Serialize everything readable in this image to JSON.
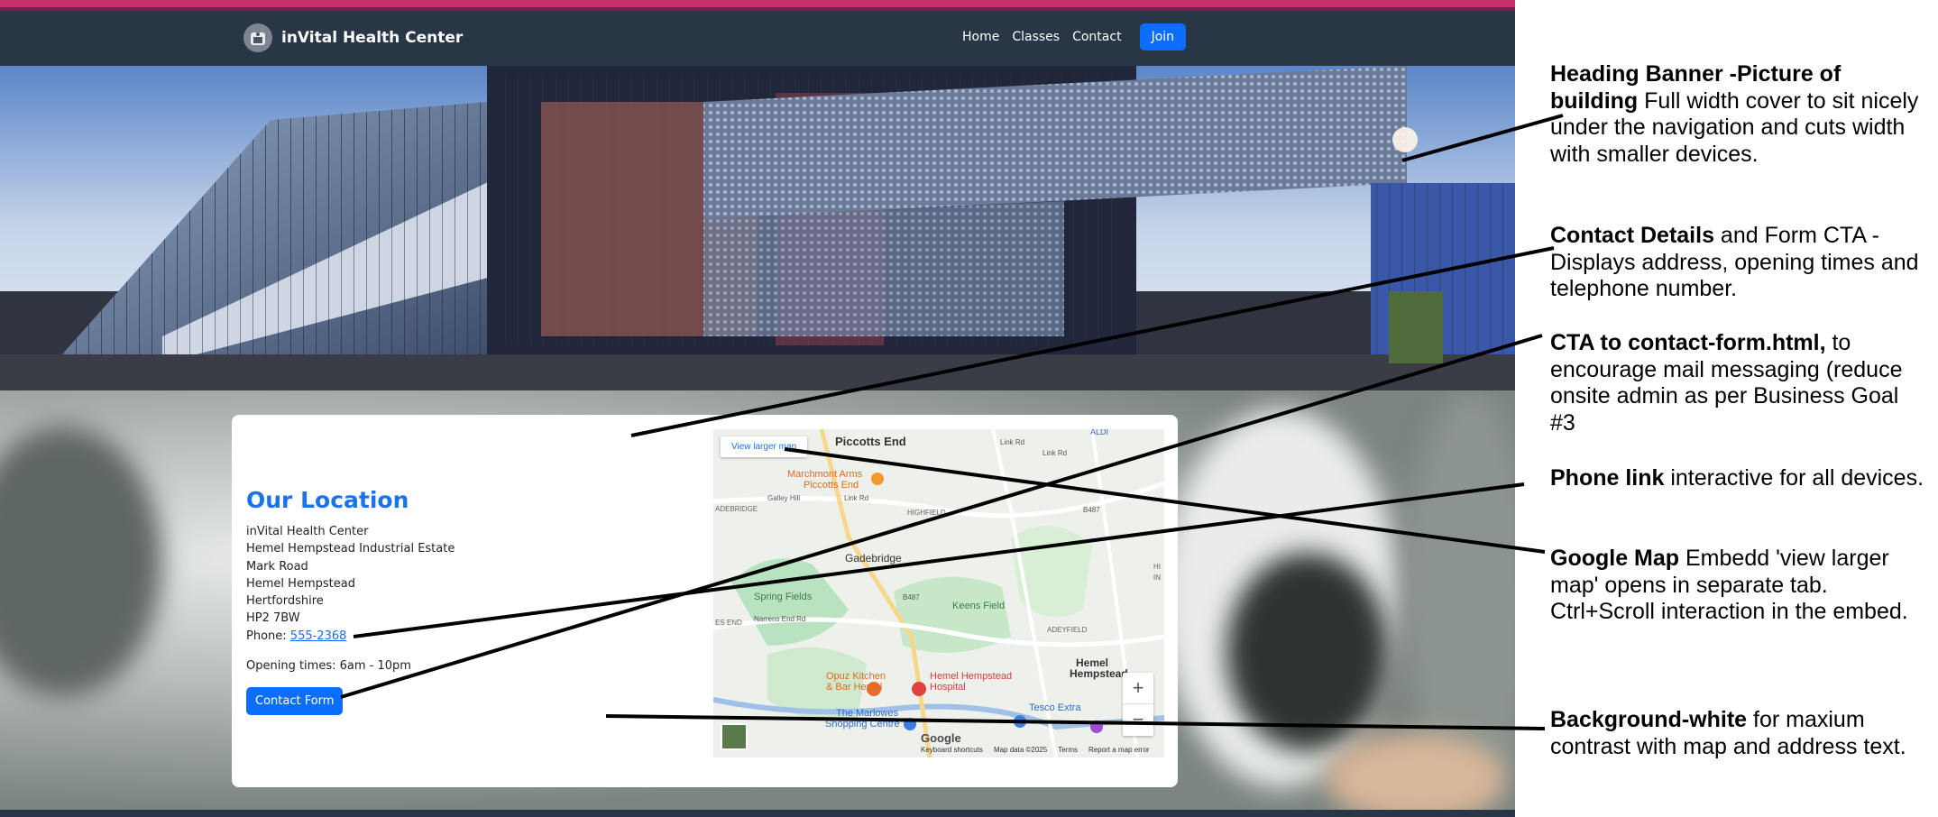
{
  "site": {
    "brand": {
      "name": "inVital Health Center"
    },
    "nav": {
      "items": [
        "Home",
        "Classes",
        "Contact"
      ],
      "join_label": "Join"
    },
    "location": {
      "title": "Our Location",
      "address_lines": [
        "inVital Health Center",
        "Hemel Hempstead Industrial Estate",
        "Mark Road",
        "Hemel Hempstead",
        "Hertfordshire",
        "HP2 7BW"
      ],
      "phone_label": "Phone:",
      "phone_number": "555-2368",
      "opening_times": "Opening times: 6am - 10pm",
      "contact_button": "Contact Form"
    },
    "map": {
      "view_larger": "View larger map",
      "labels": [
        "Piccotts End",
        "Marchmont Arms",
        "Piccotts End",
        "Link Rd",
        "Gadebridge",
        "Spring Fields",
        "Keens Field",
        "Opuz Kitchen",
        "& Bar Hemel",
        "Hemel Hempstead",
        "Hospital",
        "The Marlowes",
        "Shopping Centre",
        "Tesco Extra",
        "Hemel",
        "Hempstead",
        "HIGHFIELD",
        "ADEYFIELD",
        "ADEBRIDGE",
        "B487",
        "B487",
        "Link Rd",
        "Link Rd",
        "Galley Hill",
        "Narrens End Rd",
        "ES END",
        "ALDI",
        "HI",
        "IN"
      ],
      "footer": [
        "Keyboard shortcuts",
        "Map data ©2025",
        "Terms",
        "Report a map error"
      ],
      "google": "Google",
      "zoom_in": "+",
      "zoom_out": "−"
    }
  },
  "annotations": [
    {
      "bold": "Heading Banner  -Picture of building",
      "text": " Full width cover to sit nicely under the navigation and cuts width with smaller devices."
    },
    {
      "bold": "Contact Details",
      "text": " and Form CTA - Displays address, opening times and telephone number."
    },
    {
      "bold": "CTA to contact-form.html,",
      "text": " to encourage mail messaging (reduce onsite admin as per Business Goal #3"
    },
    {
      "bold": "Phone link",
      "text": " interactive for all devices."
    },
    {
      "bold": "Google Map",
      "text": " Embedd 'view larger map' opens in separate tab. Ctrl+Scroll interaction in the embed."
    },
    {
      "bold": "Background-white",
      "text": " for maxium contrast with map and address text."
    }
  ],
  "colors": {
    "navbar": "#283645",
    "accent": "#0d6efd",
    "title_blue": "#1a73e8",
    "top_strip": "#c7306a"
  }
}
